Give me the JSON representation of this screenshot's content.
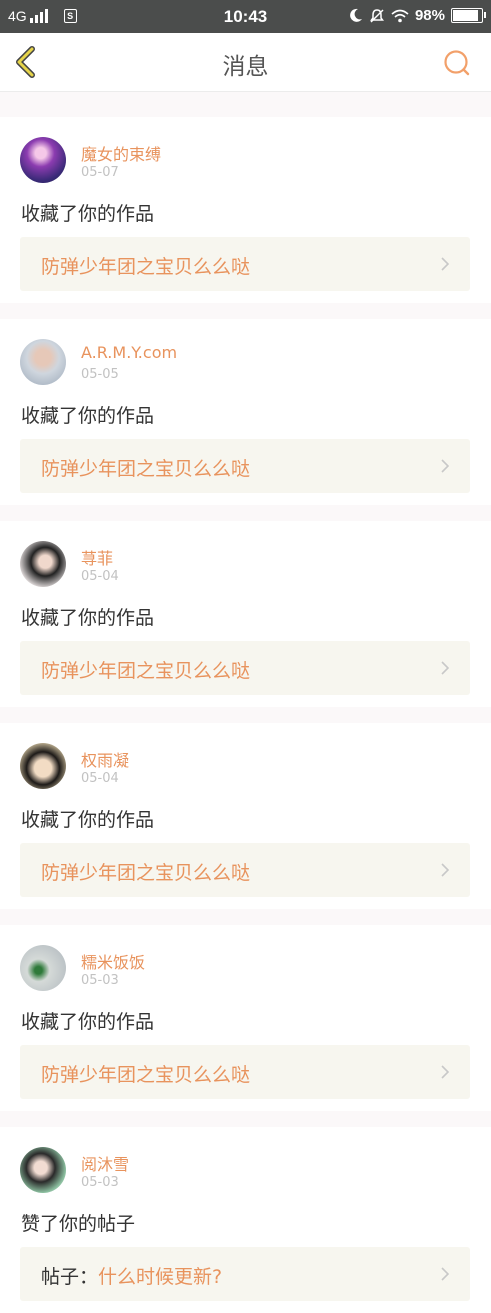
{
  "status_bar": {
    "network": "4G",
    "sim_label": "S",
    "time": "10:43",
    "battery": "98%",
    "battery_level": 0.98
  },
  "header": {
    "title": "消息",
    "back_icon": "chevron-left-icon",
    "search_icon": "search-icon"
  },
  "colors": {
    "accent": "#e8935d",
    "back_icon": "#c5b33a",
    "status_bar": "#4b4d4c",
    "link_bg": "#f7f6ef"
  },
  "messages": [
    {
      "username": "魔女的束缚",
      "date": "05-07",
      "action": "收藏了你的作品",
      "link_prefix": "",
      "link_title": "防弹少年团之宝贝么么哒"
    },
    {
      "username": "A.R.M.Y.com",
      "date": "05-05",
      "action": "收藏了你的作品",
      "link_prefix": "",
      "link_title": "防弹少年团之宝贝么么哒"
    },
    {
      "username": "荨菲",
      "date": "05-04",
      "action": "收藏了你的作品",
      "link_prefix": "",
      "link_title": "防弹少年团之宝贝么么哒"
    },
    {
      "username": "权雨凝",
      "date": "05-04",
      "action": "收藏了你的作品",
      "link_prefix": "",
      "link_title": "防弹少年团之宝贝么么哒"
    },
    {
      "username": "糯米饭饭",
      "date": "05-03",
      "action": "收藏了你的作品",
      "link_prefix": "",
      "link_title": "防弹少年团之宝贝么么哒"
    },
    {
      "username": "阅沐雪",
      "date": "05-03",
      "action": "赞了你的帖子",
      "link_prefix": "帖子：",
      "link_title": "什么时候更新?"
    }
  ]
}
